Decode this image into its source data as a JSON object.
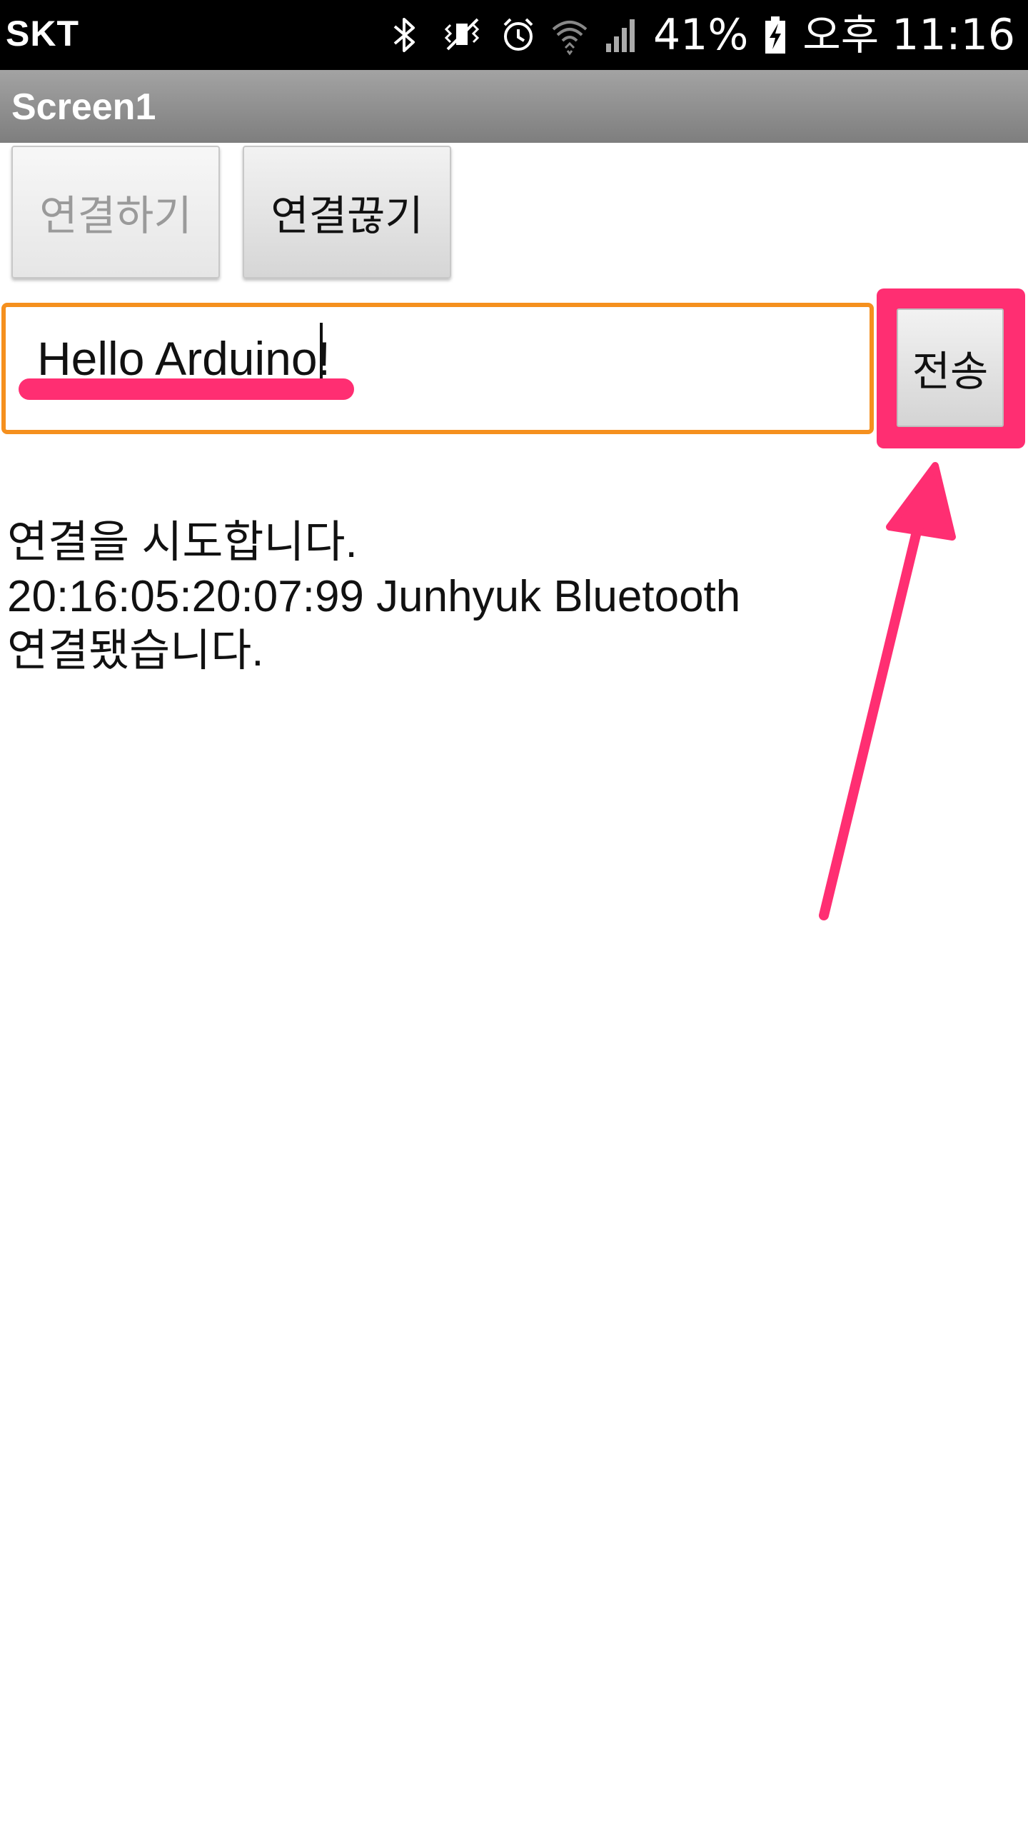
{
  "status_bar": {
    "carrier": "SKT",
    "battery_percent": "41%",
    "ampm": "오후",
    "time": "11:16",
    "icons": [
      "bluetooth-icon",
      "vibrate-icon",
      "alarm-icon",
      "wifi-icon",
      "signal-icon",
      "battery-charging-icon"
    ]
  },
  "title_bar": {
    "title": "Screen1"
  },
  "buttons": {
    "connect_label": "연결하기",
    "disconnect_label": "연결끊기",
    "send_label": "전송"
  },
  "message_input": {
    "value": "Hello Arduino!"
  },
  "log": {
    "lines": [
      "연결을 시도합니다.",
      "20:16:05:20:07:99 Junhyuk Bluetooth",
      "연결됐습니다."
    ]
  },
  "colors": {
    "highlight": "#ff2e72",
    "input_border": "#f5901e",
    "title_bar": "#8f8f8f"
  }
}
